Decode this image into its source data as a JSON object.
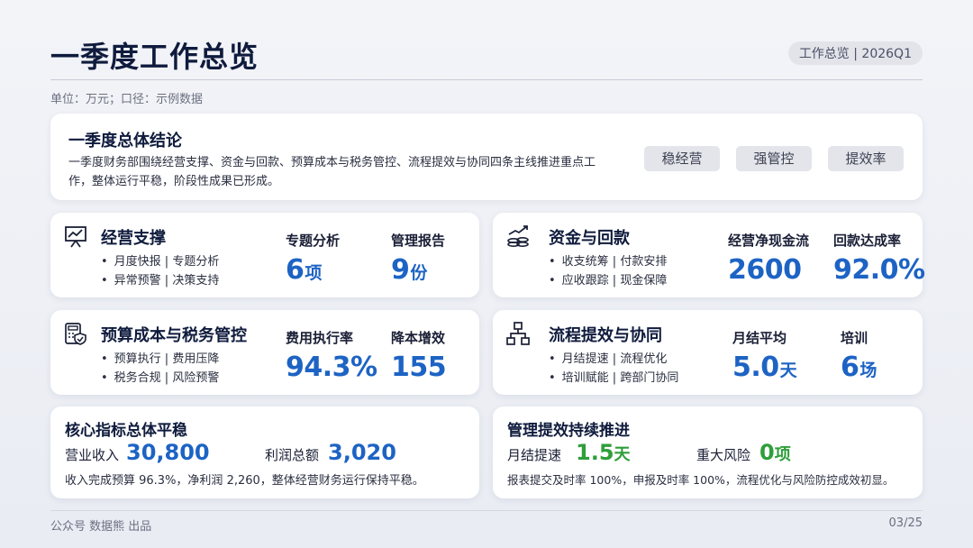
{
  "header": {
    "title": "一季度工作总览",
    "tag": "工作总览 | 2026Q1",
    "unit": "单位：万元；口径：示例数据"
  },
  "summary": {
    "title": "一季度总体结论",
    "text": "一季度财务部围绕经营支撑、资金与回款、预算成本与税务管控、流程提效与协同四条主线推进重点工作，整体运行平稳，阶段性成果已形成。",
    "pills": [
      "稳经营",
      "强管控",
      "提效率"
    ]
  },
  "tiles": [
    {
      "title": "经营支撑",
      "icon": "presentation-chart-icon",
      "bullets": [
        "月度快报 | 专题分析",
        "异常预警 | 决策支持"
      ],
      "metrics": [
        {
          "label": "专题分析",
          "value": "6",
          "unit": "项"
        },
        {
          "label": "管理报告",
          "value": "9",
          "unit": "份"
        }
      ]
    },
    {
      "title": "资金与回款",
      "icon": "coins-growth-icon",
      "bullets": [
        "收支统筹 | 付款安排",
        "应收跟踪 | 现金保障"
      ],
      "metrics": [
        {
          "label": "经营净现金流",
          "value": "2600",
          "unit": ""
        },
        {
          "label": "回款达成率",
          "value": "92.0%",
          "unit": ""
        }
      ]
    },
    {
      "title": "预算成本与税务管控",
      "icon": "calculator-shield-icon",
      "bullets": [
        "预算执行 | 费用压降",
        "税务合规 | 风险预警"
      ],
      "metrics": [
        {
          "label": "费用执行率",
          "value": "94.3%",
          "unit": ""
        },
        {
          "label": "降本增效",
          "value": "155",
          "unit": ""
        }
      ]
    },
    {
      "title": "流程提效与协同",
      "icon": "flowchart-icon",
      "bullets": [
        "月结提速 | 流程优化",
        "培训赋能 | 跨部门协同"
      ],
      "metrics": [
        {
          "label": "月结平均",
          "value": "5.0",
          "unit": "天"
        },
        {
          "label": "培训",
          "value": "6",
          "unit": "场"
        }
      ]
    }
  ],
  "bottom_left": {
    "title": "核心指标总体平稳",
    "k1_label": "营业收入",
    "k1_value": "30,800",
    "k2_label": "利润总额",
    "k2_value": "3,020",
    "note": "收入完成预算 96.3%，净利润 2,260，整体经营财务运行保持平稳。"
  },
  "bottom_right": {
    "title": "管理提效持续推进",
    "k1_label": "月结提速",
    "k1_value": "1.5",
    "k1_unit": "天",
    "k2_label": "重大风险",
    "k2_value": "0",
    "k2_unit": "项",
    "note": "报表提交及时率 100%，申报及时率 100%，流程优化与风险防控成效初显。"
  },
  "footer": {
    "left": "公众号 数据熊 出品",
    "right": "03/25"
  },
  "colors": {
    "accent_blue": "#1d63c4",
    "accent_green": "#2e9e3a",
    "navy": "#0f1b3d"
  }
}
